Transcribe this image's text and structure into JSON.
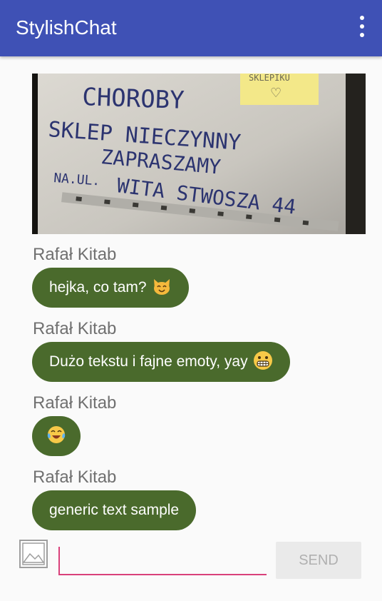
{
  "app": {
    "title": "StylishChat",
    "colors": {
      "toolbar": "#3f51b5",
      "bubble": "#4a6a2c",
      "accent": "#d9407a"
    }
  },
  "toolbar": {
    "overflow_icon": "more-vert-icon"
  },
  "messages": [
    {
      "type": "image",
      "sender": "",
      "sign_text": "CHOROBY SKLEP NIECZYNNY ZAPRASZAMY NA UL. WITA STWOSZA 44",
      "sticky_note": "SKLEPIKU ♡"
    },
    {
      "sender": "Rafał Kitab",
      "text": "hejka, co tam?",
      "emoji": "cat-smile-icon"
    },
    {
      "sender": "Rafał Kitab",
      "text": "Dużo tekstu i fajne emoty, yay",
      "emoji": "grimacing-face-icon"
    },
    {
      "sender": "Rafał Kitab",
      "text": "",
      "emoji": "tears-of-joy-icon"
    },
    {
      "sender": "Rafał Kitab",
      "text": "generic text sample",
      "emoji": ""
    }
  ],
  "composer": {
    "image_button_icon": "image-icon",
    "input_value": "",
    "input_placeholder": "",
    "send_label": "SEND"
  }
}
